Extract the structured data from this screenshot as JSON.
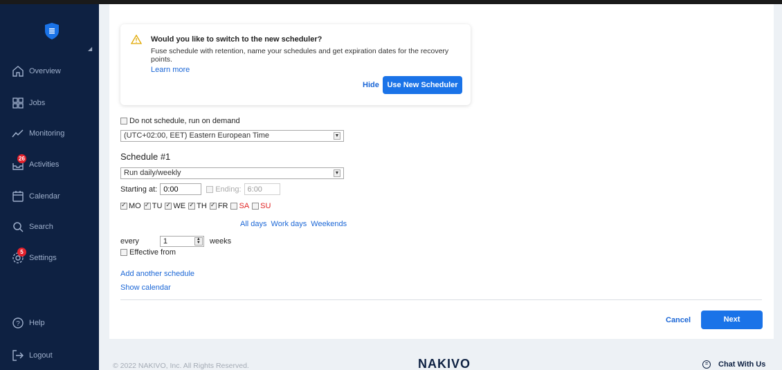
{
  "sidebar": {
    "items": [
      {
        "label": "Overview",
        "icon": "home-icon"
      },
      {
        "label": "Jobs",
        "icon": "grid-icon"
      },
      {
        "label": "Monitoring",
        "icon": "trend-icon"
      },
      {
        "label": "Activities",
        "icon": "inbox-icon",
        "badge": "26"
      },
      {
        "label": "Calendar",
        "icon": "calendar-icon"
      },
      {
        "label": "Search",
        "icon": "search-icon"
      },
      {
        "label": "Settings",
        "icon": "gear-icon",
        "badge": "5"
      },
      {
        "label": "Help",
        "icon": "help-icon"
      },
      {
        "label": "Logout",
        "icon": "logout-icon"
      }
    ]
  },
  "notice": {
    "title": "Would you like to switch to the new scheduler?",
    "description": "Fuse schedule with retention, name your schedules and get expiration dates for the recovery points.",
    "learn_more": "Learn more",
    "hide": "Hide",
    "use_new": "Use New Scheduler"
  },
  "form": {
    "on_demand_label": "Do not schedule, run on demand",
    "timezone": "(UTC+02:00, EET) Eastern European Time",
    "schedule_heading": "Schedule #1",
    "frequency": "Run daily/weekly",
    "starting_label": "Starting at:",
    "starting_value": "0:00",
    "ending_label": "Ending:",
    "ending_value": "6:00",
    "days": [
      {
        "label": "MO",
        "checked": true
      },
      {
        "label": "TU",
        "checked": true
      },
      {
        "label": "WE",
        "checked": true
      },
      {
        "label": "TH",
        "checked": true
      },
      {
        "label": "FR",
        "checked": true
      },
      {
        "label": "SA",
        "checked": false
      },
      {
        "label": "SU",
        "checked": false
      }
    ],
    "quick": {
      "all": "All days",
      "work": "Work days",
      "weekends": "Weekends"
    },
    "every_label": "every",
    "every_value": "1",
    "weeks_label": "weeks",
    "effective_label": "Effective from",
    "add_schedule": "Add another schedule",
    "show_calendar": "Show calendar"
  },
  "actions": {
    "cancel": "Cancel",
    "next": "Next"
  },
  "footer": {
    "copyright": "© 2022 NAKIVO, Inc. All Rights Reserved.",
    "logo": "NAKIVO",
    "chat": "Chat With Us"
  },
  "colors": {
    "sidebar": "#0e2142",
    "accent": "#1a73e8",
    "badge": "#e3222d"
  }
}
